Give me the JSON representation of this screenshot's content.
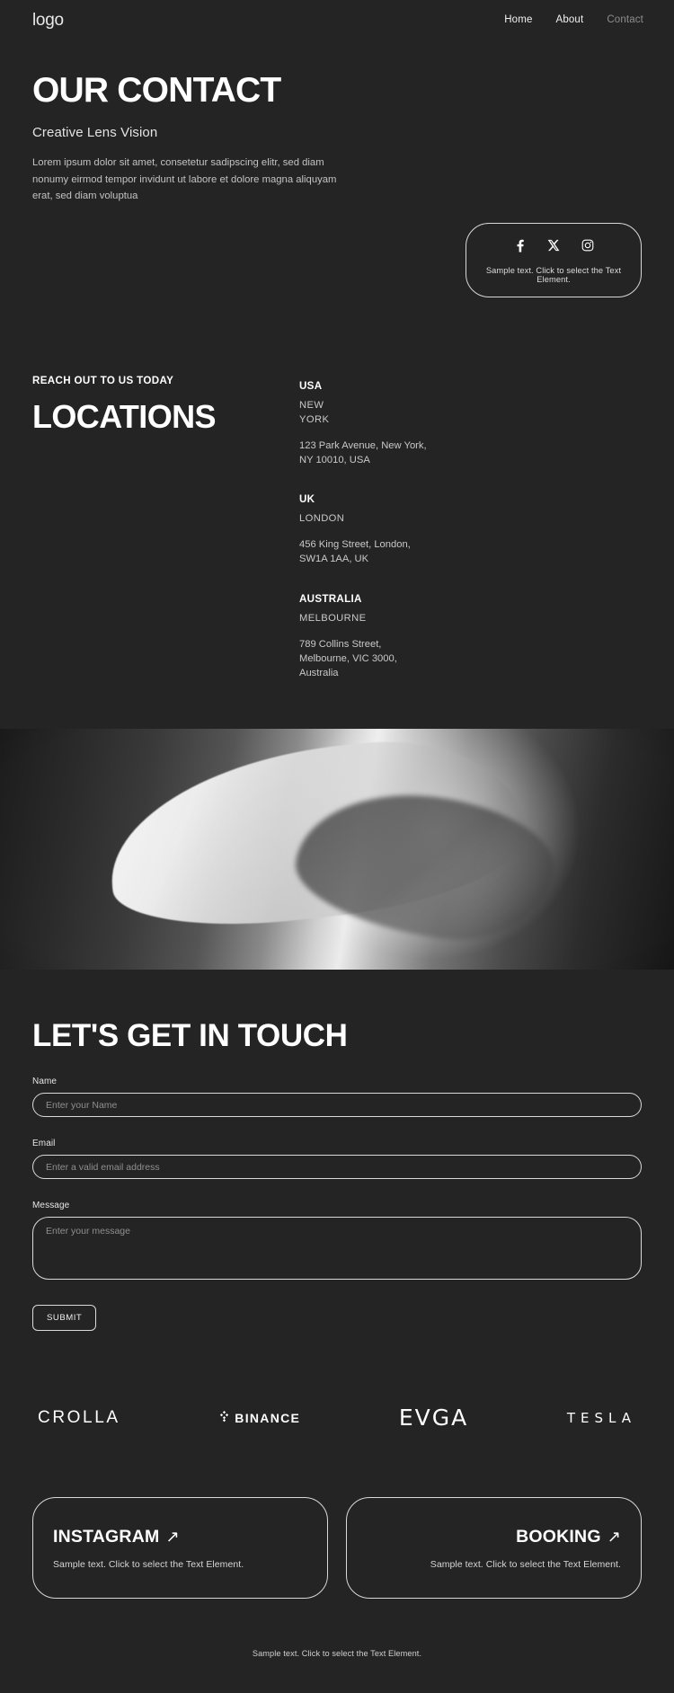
{
  "theme": {
    "background": "#242424",
    "text_primary": "#ffffff",
    "text_muted": "#c3c3c3",
    "border": "#d8d8d8"
  },
  "header": {
    "logo": "logo",
    "nav": [
      {
        "label": "Home",
        "active": true
      },
      {
        "label": "About",
        "active": true
      },
      {
        "label": "Contact",
        "active": false
      }
    ]
  },
  "hero": {
    "title": "OUR CONTACT",
    "subtitle": "Creative Lens Vision",
    "body": "Lorem ipsum dolor sit amet, consetetur sadipscing elitr, sed diam nonumy eirmod tempor invidunt ut labore et dolore magna aliquyam erat, sed diam voluptua"
  },
  "social_card": {
    "icons": [
      {
        "name": "facebook-icon",
        "label": "Facebook"
      },
      {
        "name": "x-twitter-icon",
        "label": "X"
      },
      {
        "name": "instagram-icon",
        "label": "Instagram"
      }
    ],
    "caption": "Sample text. Click to select the Text Element."
  },
  "locations": {
    "kicker": "REACH OUT TO US TODAY",
    "title": "LOCATIONS",
    "items": [
      {
        "country": "USA",
        "city": "NEW\nYORK",
        "city_lines": [
          "NEW",
          "YORK"
        ],
        "address_lines": [
          "123 Park Avenue, New York,",
          "NY 10010, USA"
        ]
      },
      {
        "country": "UK",
        "city": "LONDON",
        "city_lines": [
          "LONDON"
        ],
        "address_lines": [
          "456 King Street, London,",
          "SW1A 1AA, UK"
        ]
      },
      {
        "country": "AUSTRALIA",
        "city": "MELBOURNE",
        "city_lines": [
          "MELBOURNE"
        ],
        "address_lines": [
          "789 Collins Street,",
          "Melbourne, VIC 3000,",
          "Australia"
        ]
      }
    ]
  },
  "image_band": {
    "alt": "black and white abstract photograph of draped fabric"
  },
  "form": {
    "title": "LET'S GET IN TOUCH",
    "fields": [
      {
        "label": "Name",
        "placeholder": "Enter your Name",
        "value": ""
      },
      {
        "label": "Email",
        "placeholder": "Enter a valid email address",
        "value": ""
      },
      {
        "label": "Message",
        "placeholder": "Enter your message",
        "value": ""
      }
    ],
    "submit_label": "SUBMIT"
  },
  "brands": [
    {
      "name": "crolla",
      "label": "CROLLA"
    },
    {
      "name": "binance",
      "label": "BINANCE"
    },
    {
      "name": "evga",
      "label": "EVGA"
    },
    {
      "name": "tesla",
      "label": "TESLA"
    }
  ],
  "cta_cards": [
    {
      "name": "instagram",
      "title": "INSTAGRAM",
      "arrow": "↗",
      "subtitle": "Sample text. Click to select the Text Element."
    },
    {
      "name": "booking",
      "title": "BOOKING",
      "arrow": "↗",
      "subtitle": "Sample text. Click to select the Text Element."
    }
  ],
  "footer": {
    "text": "Sample text. Click to select the Text Element."
  }
}
